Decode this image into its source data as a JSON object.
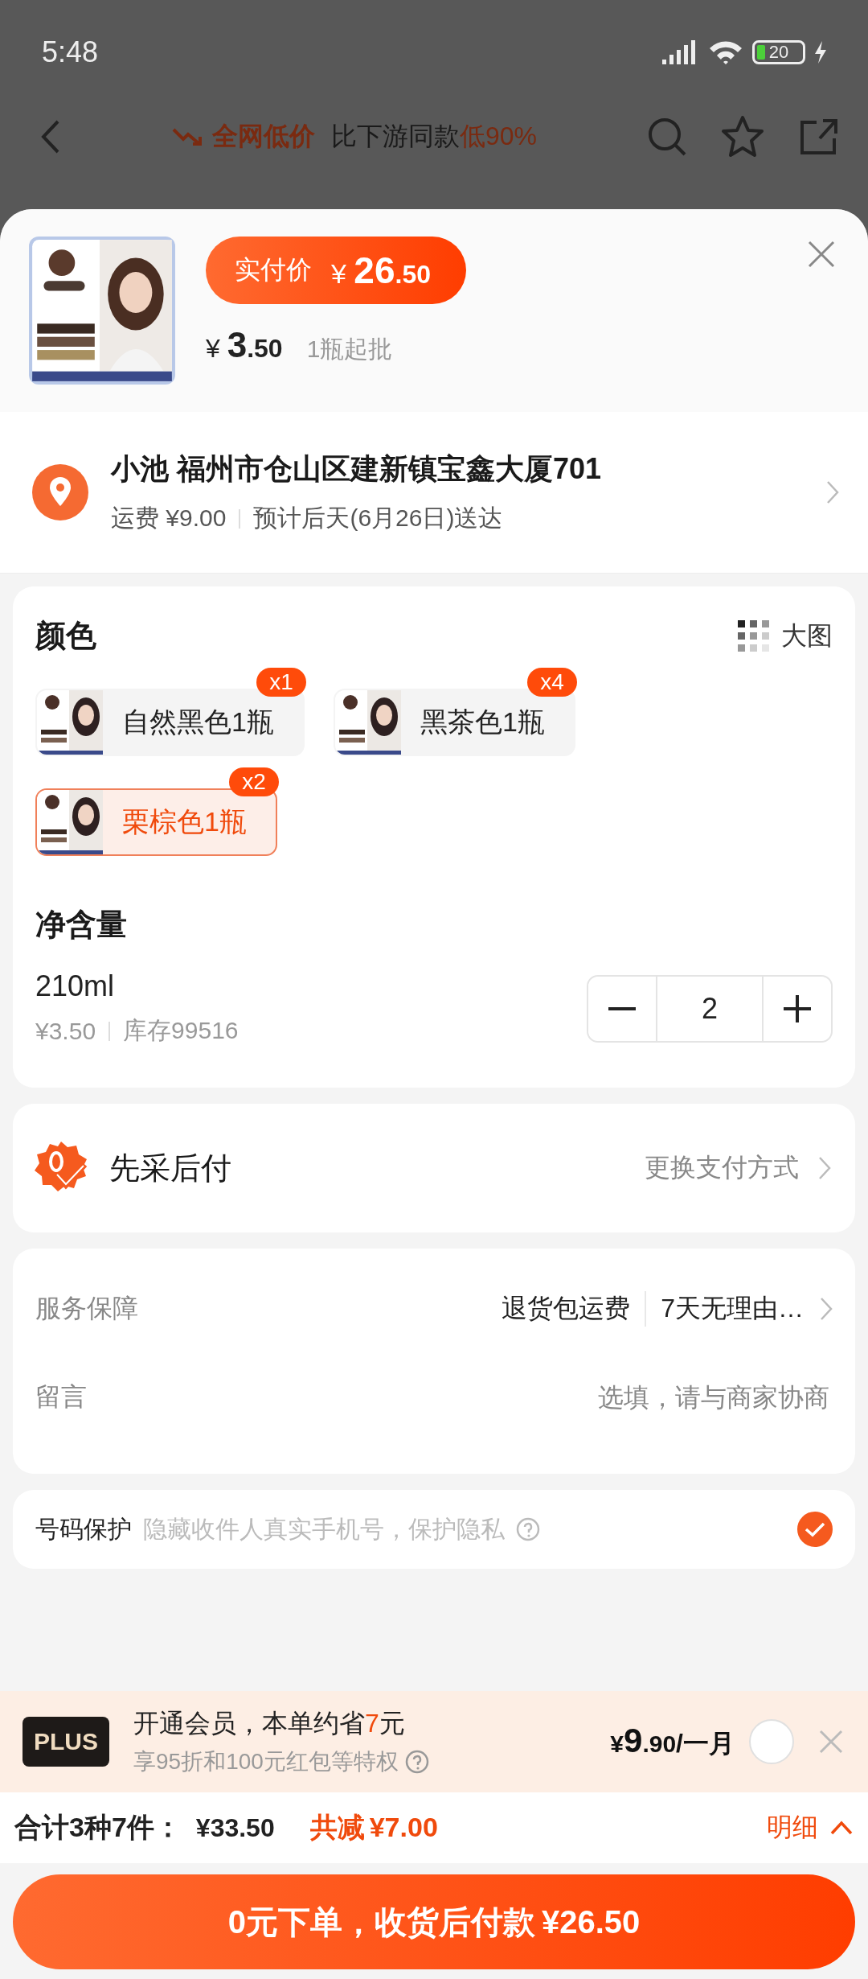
{
  "status_bar": {
    "time": "5:48",
    "battery": "20"
  },
  "nav": {
    "promo_highlight": "全网低价",
    "promo_text": "比下游同款",
    "promo_emphasis": "低90%"
  },
  "product": {
    "actual_price_label": "实付价",
    "actual_price": {
      "currency": "¥",
      "integer": "26",
      "decimal": ".50"
    },
    "unit_price": {
      "currency": "¥",
      "integer": "3",
      "decimal": ".50"
    },
    "min_order": "1瓶起批"
  },
  "address": {
    "name": "小池",
    "address": "福州市仓山区建新镇宝鑫大厦701",
    "shipping": "运费 ¥9.00",
    "eta": "预计后天(6月26日)送达"
  },
  "color": {
    "title": "颜色",
    "view_toggle": "大图",
    "options": [
      {
        "label": "自然黑色1瓶",
        "count": "x1",
        "selected": false
      },
      {
        "label": "黑茶色1瓶",
        "count": "x4",
        "selected": false
      },
      {
        "label": "栗棕色1瓶",
        "count": "x2",
        "selected": true
      }
    ]
  },
  "volume": {
    "title": "净含量",
    "option": "210ml",
    "price": "¥3.50",
    "stock": "库存99516",
    "quantity": "2"
  },
  "payment": {
    "title": "先采后付",
    "action": "更换支付方式"
  },
  "service": {
    "label": "服务保障",
    "values": [
      "退货包运费",
      "7天无理由…"
    ],
    "message_label": "留言",
    "message_placeholder": "选填，请与商家协商"
  },
  "phone_protection": {
    "label": "号码保护",
    "description": "隐藏收件人真实手机号，保护隐私",
    "checked": true
  },
  "plus": {
    "badge": "PLUS",
    "title_prefix": "开通会员，本单约省",
    "savings": "7",
    "title_suffix": "元",
    "subtitle": "享95折和100元红包等特权",
    "price": {
      "currency": "¥",
      "integer": "9",
      "decimal": ".90",
      "period": "/一月"
    },
    "selected": false
  },
  "summary": {
    "label": "合计3种7件：",
    "total": "¥33.50",
    "discount_label": "共减",
    "discount": "¥7.00",
    "details": "明细"
  },
  "submit": {
    "label": "0元下单，收货后付款",
    "amount": "¥26.50"
  }
}
